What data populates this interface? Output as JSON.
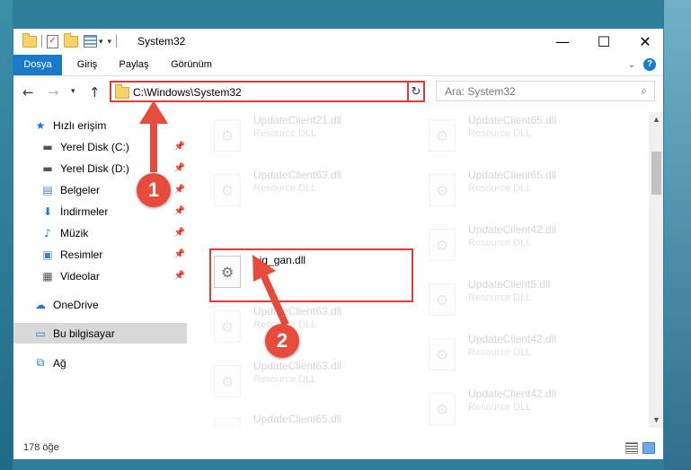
{
  "window": {
    "title": "System32"
  },
  "ribbon": {
    "tabs": [
      "Dosya",
      "Giriş",
      "Paylaş",
      "Görünüm"
    ],
    "help": "?"
  },
  "navigation": {
    "address": "C:\\Windows\\System32",
    "search_placeholder": "Ara: System32"
  },
  "sidebar": {
    "items": [
      {
        "label": "Hızlı erişim",
        "icon": "star-icon"
      },
      {
        "label": "Yerel Disk (C:)",
        "icon": "drive-icon",
        "pinned": true
      },
      {
        "label": "Yerel Disk (D:)",
        "icon": "drive-icon",
        "pinned": true
      },
      {
        "label": "Belgeler",
        "icon": "documents-icon",
        "pinned": true
      },
      {
        "label": "İndirmeler",
        "icon": "download-icon",
        "pinned": true
      },
      {
        "label": "Müzik",
        "icon": "music-icon",
        "pinned": true
      },
      {
        "label": "Resimler",
        "icon": "pictures-icon",
        "pinned": true
      },
      {
        "label": "Videolar",
        "icon": "video-icon",
        "pinned": true
      },
      {
        "label": "OneDrive",
        "icon": "cloud-icon"
      },
      {
        "label": "Bu bilgisayar",
        "icon": "computer-icon",
        "selected": true
      },
      {
        "label": "Ağ",
        "icon": "network-icon"
      }
    ]
  },
  "files": {
    "left": [
      {
        "name": "UpdateClient21.dll",
        "type": "Resource DLL"
      },
      {
        "name": "UpdateClient63.dll",
        "type": "Resource DLL"
      },
      {
        "name": "big_gan.dll",
        "type": "",
        "highlighted": true
      },
      {
        "name": "UpdateClient63.dll",
        "type": "Resource DLL"
      },
      {
        "name": "UpdateClient63.dll",
        "type": "Resource DLL"
      },
      {
        "name": "UpdateClient65.dll",
        "type": "Resource DLL"
      }
    ],
    "right": [
      {
        "name": "UpdateClient65.dll",
        "type": "Resource DLL"
      },
      {
        "name": "UpdateClient65.dll",
        "type": "Resource DLL"
      },
      {
        "name": "UpdateClient42.dll",
        "type": "Resource DLL"
      },
      {
        "name": "UpdateClient5.dll",
        "type": "Resource DLL"
      },
      {
        "name": "UpdateClient42.dll",
        "type": "Resource DLL"
      },
      {
        "name": "UpdateClient42.dll",
        "type": "Resource DLL"
      }
    ]
  },
  "status": {
    "count": "178 öğe"
  },
  "annotations": {
    "step1": "1",
    "step2": "2"
  },
  "colors": {
    "accent": "#1979ca",
    "highlight": "#e53935",
    "badge": "#e64b3b"
  }
}
